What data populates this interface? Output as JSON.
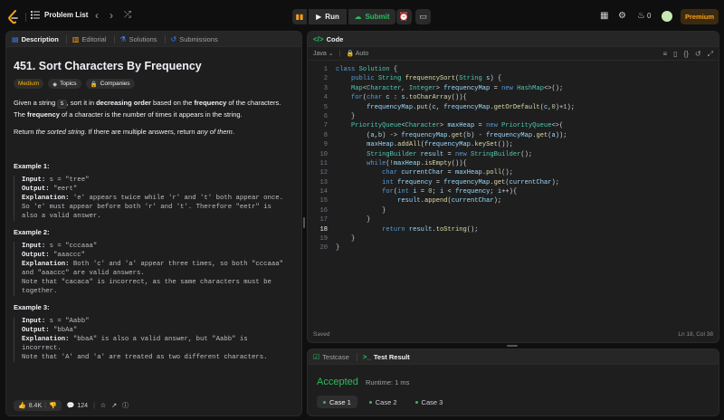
{
  "topbar": {
    "problem_list": "Problem List",
    "run": "Run",
    "submit": "Submit",
    "streak": "0",
    "premium": "Premium",
    "accent": "#ffa116"
  },
  "left_tabs": [
    "Description",
    "Editorial",
    "Solutions",
    "Submissions"
  ],
  "problem": {
    "title": "451. Sort Characters By Frequency",
    "difficulty": "Medium",
    "tag_topics": "Topics",
    "tag_companies": "Companies",
    "p1_a": "Given a string ",
    "p1_code": "s",
    "p1_b": ", sort it in ",
    "p1_bold1": "decreasing order",
    "p1_c": " based on the ",
    "p1_bold2": "frequency",
    "p1_d": " of the characters. The ",
    "p1_bold3": "frequency",
    "p1_e": " of a character is the number of times it appears in the string.",
    "p2_a": "Return ",
    "p2_i1": "the sorted string",
    "p2_b": ". If there are multiple answers, return ",
    "p2_i2": "any of them",
    "p2_c": ".",
    "examples": [
      {
        "title": "Example 1:",
        "lines": [
          [
            "Input:",
            " s = \"tree\""
          ],
          [
            "Output:",
            " \"eert\""
          ],
          [
            "Explanation:",
            " 'e' appears twice while 'r' and 't' both appear once."
          ],
          [
            "",
            "So 'e' must appear before both 'r' and 't'. Therefore \"eetr\" is"
          ],
          [
            "",
            "also a valid answer."
          ]
        ]
      },
      {
        "title": "Example 2:",
        "lines": [
          [
            "Input:",
            " s = \"cccaaa\""
          ],
          [
            "Output:",
            " \"aaaccc\""
          ],
          [
            "Explanation:",
            " Both 'c' and 'a' appear three times, so both \"cccaaa\""
          ],
          [
            "",
            "and \"aaaccc\" are valid answers."
          ],
          [
            "",
            "Note that \"cacaca\" is incorrect, as the same characters must be"
          ],
          [
            "",
            "together."
          ]
        ]
      },
      {
        "title": "Example 3:",
        "lines": [
          [
            "Input:",
            " s = \"Aabb\""
          ],
          [
            "Output:",
            " \"bbAa\""
          ],
          [
            "Explanation:",
            " \"bbaA\" is also a valid answer, but \"Aabb\" is"
          ],
          [
            "",
            "incorrect."
          ],
          [
            "",
            "Note that 'A' and 'a' are treated as two different characters."
          ]
        ]
      }
    ],
    "likes": "8.4K",
    "comments": "124"
  },
  "editor": {
    "tab": "Code",
    "language": "Java",
    "mode": "Auto",
    "status": "Saved",
    "cursor": "Ln 18, Col 38",
    "current_line": 18,
    "lines": [
      "class Solution {",
      "    public String frequencySort(String s) {",
      "    Map<Character, Integer> frequencyMap = new HashMap<>();",
      "    for(char c : s.toCharArray()){",
      "        frequencyMap.put(c, frequencyMap.getOrDefault(c,0)+1);",
      "    }",
      "    PriorityQueue<Character> maxHeap = new PriorityQueue<>(",
      "        (a,b) -> frequencyMap.get(b) - frequencyMap.get(a));",
      "        maxHeap.addAll(frequencyMap.keySet());",
      "        StringBuilder result = new StringBuilder();",
      "        while(!maxHeap.isEmpty()){",
      "            char currentChar = maxHeap.poll();",
      "            int frequency = frequencyMap.get(currentChar);",
      "            for(int i = 0; i < frequency; i++){",
      "                result.append(currentChar);",
      "            }",
      "        }",
      "            return result.toString();",
      "    }",
      "}"
    ]
  },
  "tests": {
    "tab_testcase": "Testcase",
    "tab_result": "Test Result",
    "verdict": "Accepted",
    "runtime": "Runtime: 1 ms",
    "cases": [
      "Case 1",
      "Case 2",
      "Case 3"
    ],
    "verdict_color": "#2cbb5d"
  }
}
